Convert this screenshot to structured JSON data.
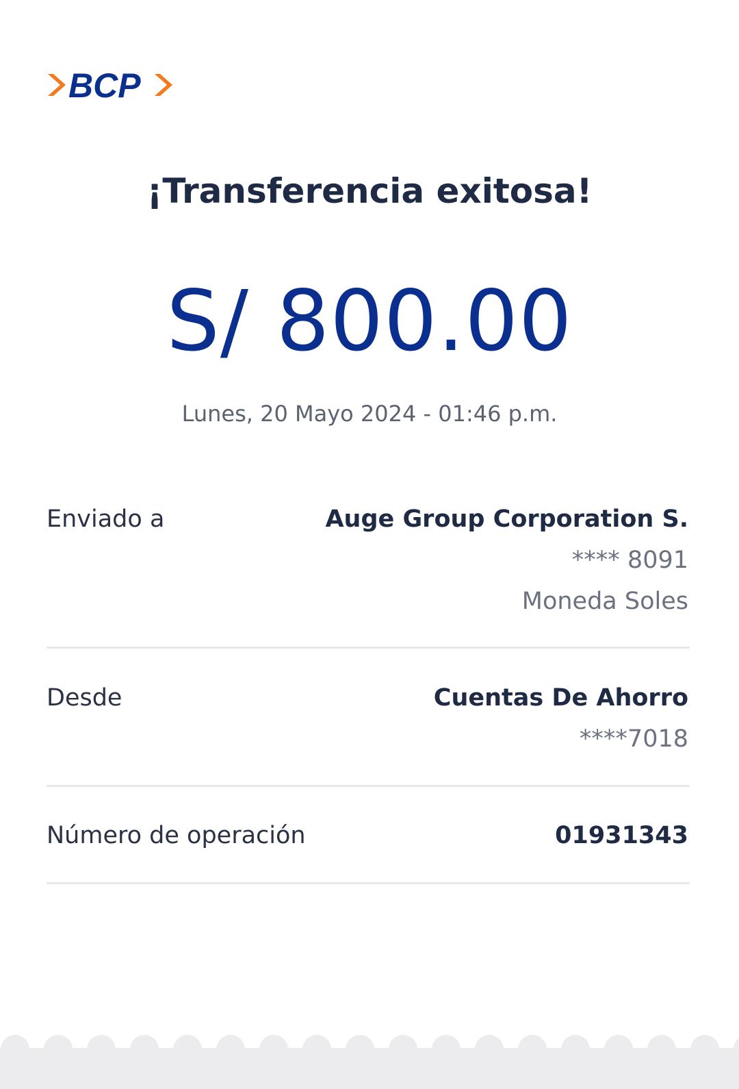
{
  "brand": {
    "name": "BCP",
    "primary_color": "#0b2f8f",
    "accent_color": "#f47a20"
  },
  "receipt": {
    "title": "¡Transferencia exitosa!",
    "amount": "S/ 800.00",
    "datetime": "Lunes, 20 Mayo 2024 - 01:46 p.m."
  },
  "details": {
    "sent_to": {
      "label": "Enviado a",
      "name": "Auge Group Corporation S.",
      "account": "**** 8091",
      "currency": "Moneda Soles"
    },
    "from": {
      "label": "Desde",
      "account_type": "Cuentas De Ahorro",
      "account": "****7018"
    },
    "operation": {
      "label": "Número de operación",
      "number": "01931343"
    }
  }
}
